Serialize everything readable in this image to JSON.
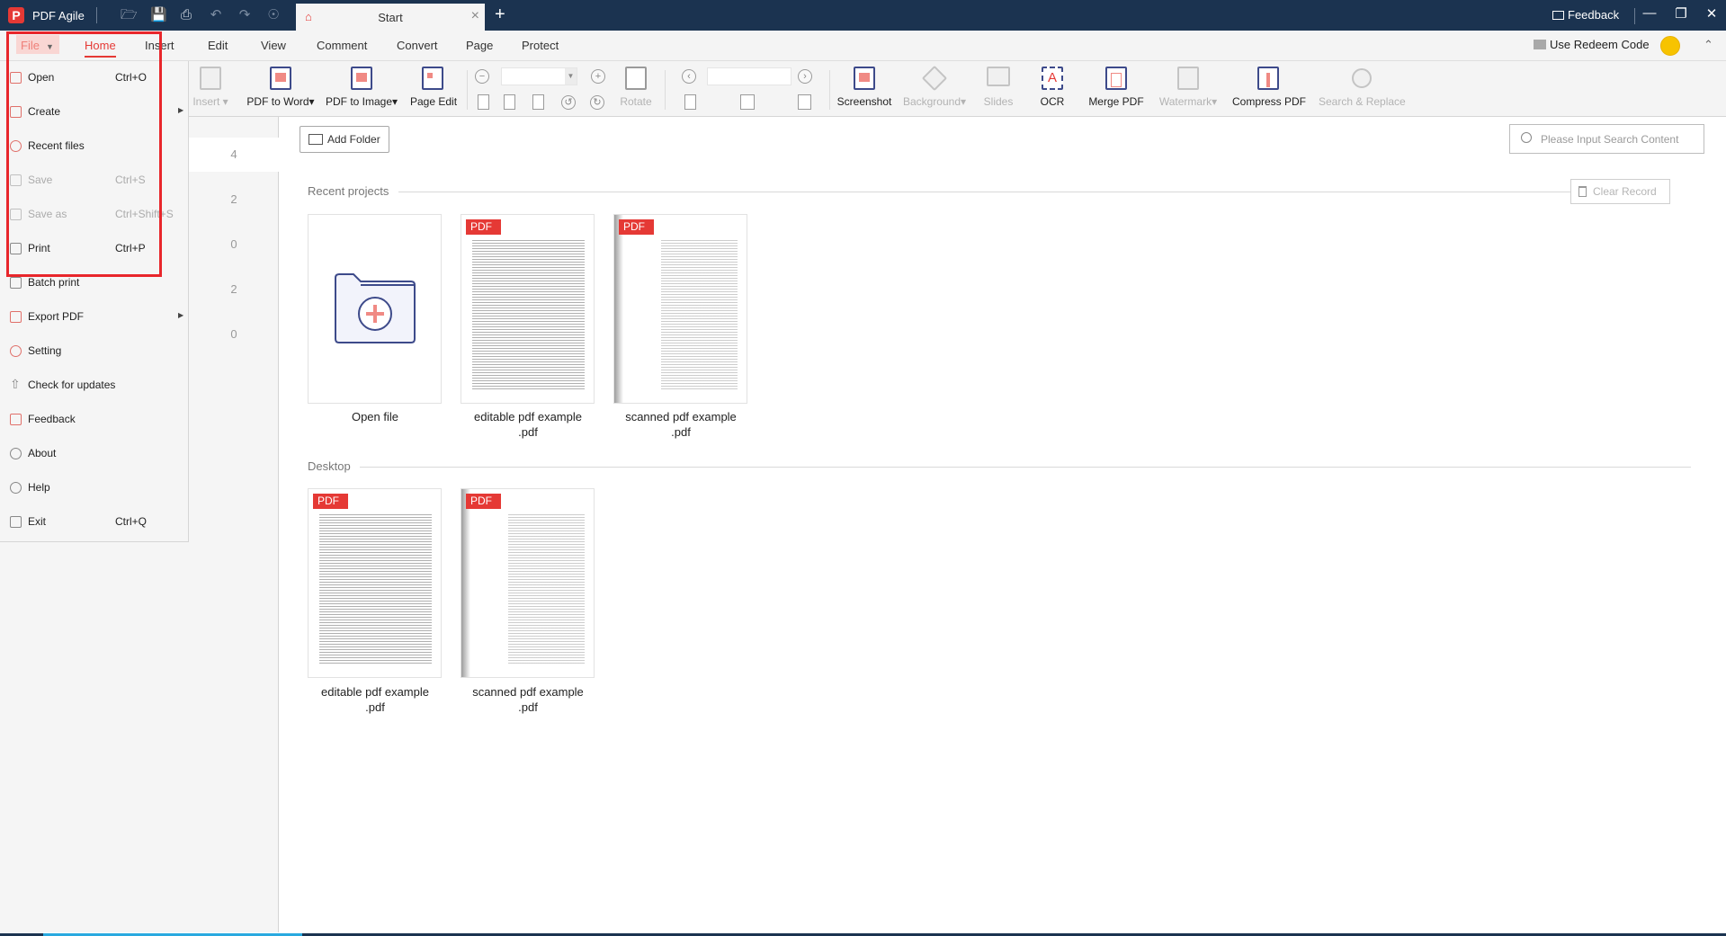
{
  "titlebar": {
    "app_name": "PDF Agile",
    "logo_glyph": "P",
    "quick_icons": [
      "open-folder-icon",
      "save-icon",
      "print-icon",
      "undo-icon",
      "redo-icon",
      "home-circle-icon"
    ],
    "tab_label": "Start",
    "feedback_label": "Feedback"
  },
  "menubar": {
    "file_label": "File",
    "tabs": [
      "Home",
      "Insert",
      "Edit",
      "View",
      "Comment",
      "Convert",
      "Page",
      "Protect"
    ],
    "active_tab": "Home",
    "redeem_label": "Use Redeem Code"
  },
  "ribbon": {
    "insert": "Insert",
    "pdf_to_word": "PDF to Word",
    "pdf_to_image": "PDF to Image",
    "page_edit": "Page Edit",
    "zoom_value": "",
    "rotate": "Rotate",
    "page_value": "",
    "screenshot": "Screenshot",
    "background": "Background",
    "slides": "Slides",
    "ocr": "OCR",
    "merge_pdf": "Merge PDF",
    "watermark": "Watermark",
    "compress_pdf": "Compress PDF",
    "search_replace": "Search & Replace"
  },
  "file_menu": {
    "items": [
      {
        "label": "Open",
        "shortcut": "Ctrl+O",
        "icon": "open-folder-icon"
      },
      {
        "label": "Create",
        "shortcut": "",
        "icon": "create-icon",
        "submenu": true
      },
      {
        "label": "Recent files",
        "shortcut": "",
        "icon": "clock-icon"
      },
      {
        "label": "Save",
        "shortcut": "Ctrl+S",
        "icon": "save-icon",
        "disabled": true
      },
      {
        "label": "Save as",
        "shortcut": "Ctrl+Shift+S",
        "icon": "save-as-icon",
        "disabled": true
      },
      {
        "label": "Print",
        "shortcut": "Ctrl+P",
        "icon": "print-icon"
      },
      {
        "label": "Batch print",
        "shortcut": "",
        "icon": "batch-print-icon"
      },
      {
        "label": "Export PDF",
        "shortcut": "",
        "icon": "export-icon",
        "submenu": true
      },
      {
        "label": "Setting",
        "shortcut": "",
        "icon": "gear-icon"
      },
      {
        "label": "Check for updates",
        "shortcut": "",
        "icon": "update-arrow-icon"
      },
      {
        "label": "Feedback",
        "shortcut": "",
        "icon": "feedback-icon"
      },
      {
        "label": "About",
        "shortcut": "",
        "icon": "info-icon"
      },
      {
        "label": "Help",
        "shortcut": "",
        "icon": "help-icon"
      },
      {
        "label": "Exit",
        "shortcut": "Ctrl+Q",
        "icon": "exit-icon"
      }
    ]
  },
  "sidebar": {
    "counts": [
      "4",
      "2",
      "0",
      "2",
      "0"
    ]
  },
  "content": {
    "add_folder_label": "Add Folder",
    "search_placeholder": "Please Input Search Content",
    "clear_record_label": "Clear Record",
    "recent_label": "Recent projects",
    "recent_items": [
      {
        "line1": "Open file",
        "line2": ""
      },
      {
        "line1": "editable pdf example",
        "line2": ".pdf",
        "badge": "PDF"
      },
      {
        "line1": "scanned pdf example",
        "line2": ".pdf",
        "badge": "PDF"
      }
    ],
    "desktop_label": "Desktop",
    "desktop_items": [
      {
        "line1": "editable pdf example",
        "line2": ".pdf",
        "badge": "PDF"
      },
      {
        "line1": "scanned pdf example",
        "line2": ".pdf",
        "badge": "PDF"
      }
    ]
  },
  "colors": {
    "titlebar": "#1b3350",
    "accent": "#e53935",
    "highlight_box": "#e8262b"
  }
}
